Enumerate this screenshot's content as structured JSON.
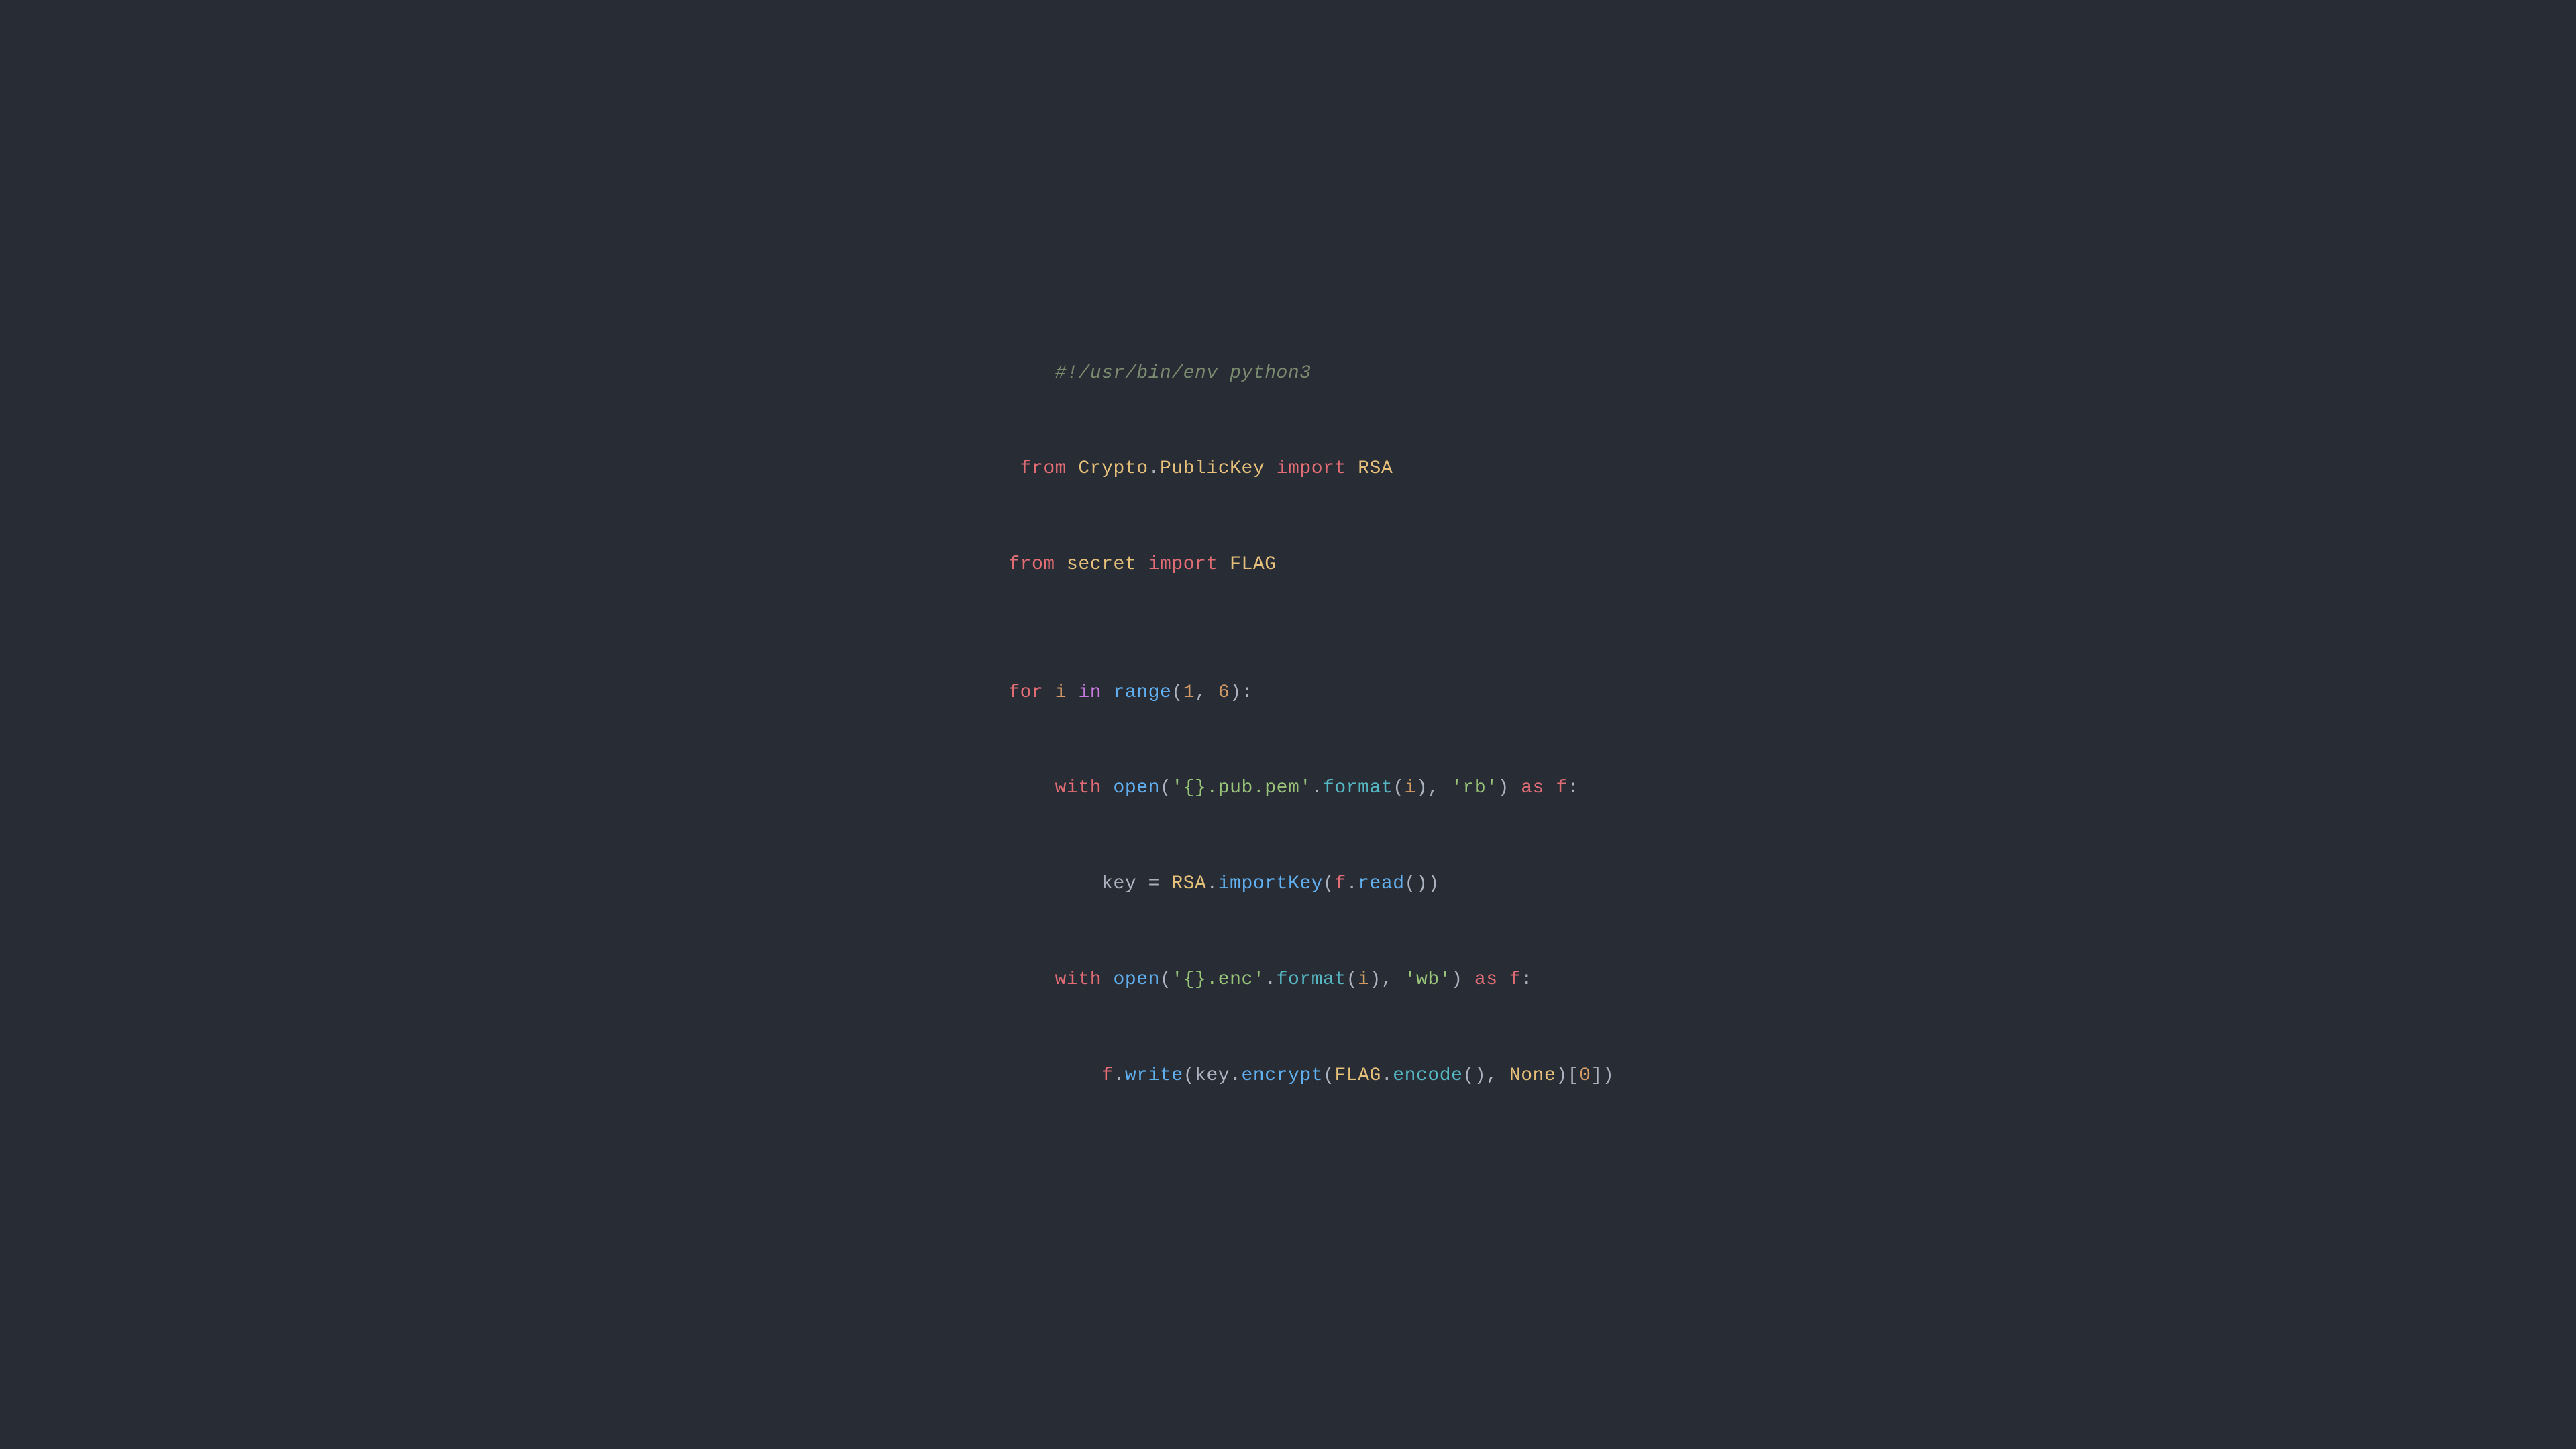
{
  "code": {
    "bg": "#282c34",
    "lines": [
      {
        "id": "shebang",
        "indent": "    ",
        "content": "#!/usr/bin/env python3",
        "type": "comment"
      },
      {
        "id": "import1",
        "content": "from Crypto.PublicKey import RSA"
      },
      {
        "id": "import2",
        "content": "from secret import FLAG"
      },
      {
        "id": "blank1",
        "content": ""
      },
      {
        "id": "for-loop",
        "content": "for i in range(1, 6):"
      },
      {
        "id": "with1",
        "content": "    with open('{}.pub.pem'.format(i), 'rb') as f:"
      },
      {
        "id": "key-assign",
        "content": "        key = RSA.importKey(f.read())"
      },
      {
        "id": "with2",
        "content": "    with open('{}.enc'.format(i), 'wb') as f:"
      },
      {
        "id": "write",
        "content": "        f.write(key.encrypt(FLAG.encode(), None)[0])"
      }
    ]
  }
}
